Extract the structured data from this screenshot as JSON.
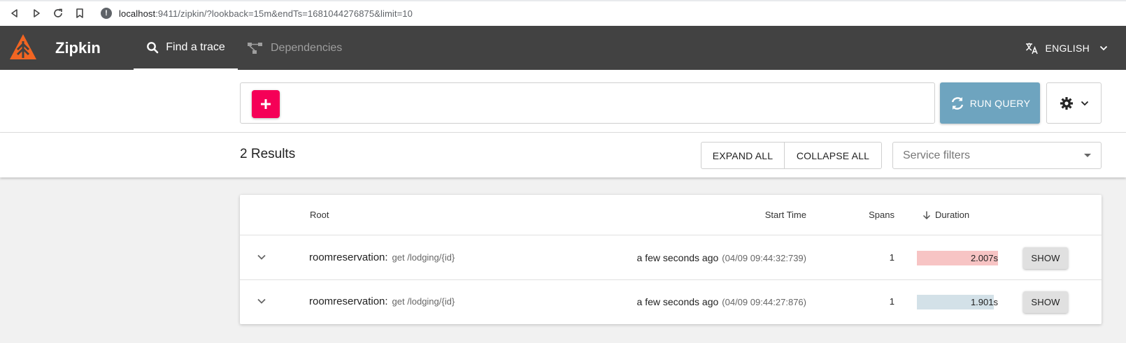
{
  "browser": {
    "url_host": "localhost",
    "url_rest": ":9411/zipkin/?lookback=15m&endTs=1681044276875&limit=10"
  },
  "header": {
    "brand": "Zipkin",
    "tabs": [
      {
        "label": "Find a trace",
        "icon": "search-icon",
        "active": true
      },
      {
        "label": "Dependencies",
        "icon": "dependencies-icon",
        "active": false
      }
    ],
    "language": "ENGLISH"
  },
  "query": {
    "run_label": "RUN QUERY"
  },
  "results": {
    "count_label": "2 Results",
    "expand_all": "EXPAND ALL",
    "collapse_all": "COLLAPSE ALL",
    "service_filter_placeholder": "Service filters"
  },
  "table": {
    "columns": {
      "root": "Root",
      "start_time": "Start Time",
      "spans": "Spans",
      "duration": "Duration"
    },
    "rows": [
      {
        "service": "roomreservation:",
        "operation": "get /lodging/{id}",
        "start_relative": "a few seconds ago",
        "start_absolute": "(04/09 09:44:32:739)",
        "spans": "1",
        "duration": "2.007s",
        "duration_fraction": 1.0,
        "bar_color": "#f7c4c4",
        "show_label": "SHOW"
      },
      {
        "service": "roomreservation:",
        "operation": "get /lodging/{id}",
        "start_relative": "a few seconds ago",
        "start_absolute": "(04/09 09:44:27:876)",
        "spans": "1",
        "duration": "1.901s",
        "duration_fraction": 0.947,
        "bar_color": "#d3e1e8",
        "show_label": "SHOW"
      }
    ]
  },
  "colors": {
    "appbar": "#424242",
    "accent_pink": "#f50057",
    "run_query": "#6ea4bf",
    "logo": "#f26522"
  }
}
